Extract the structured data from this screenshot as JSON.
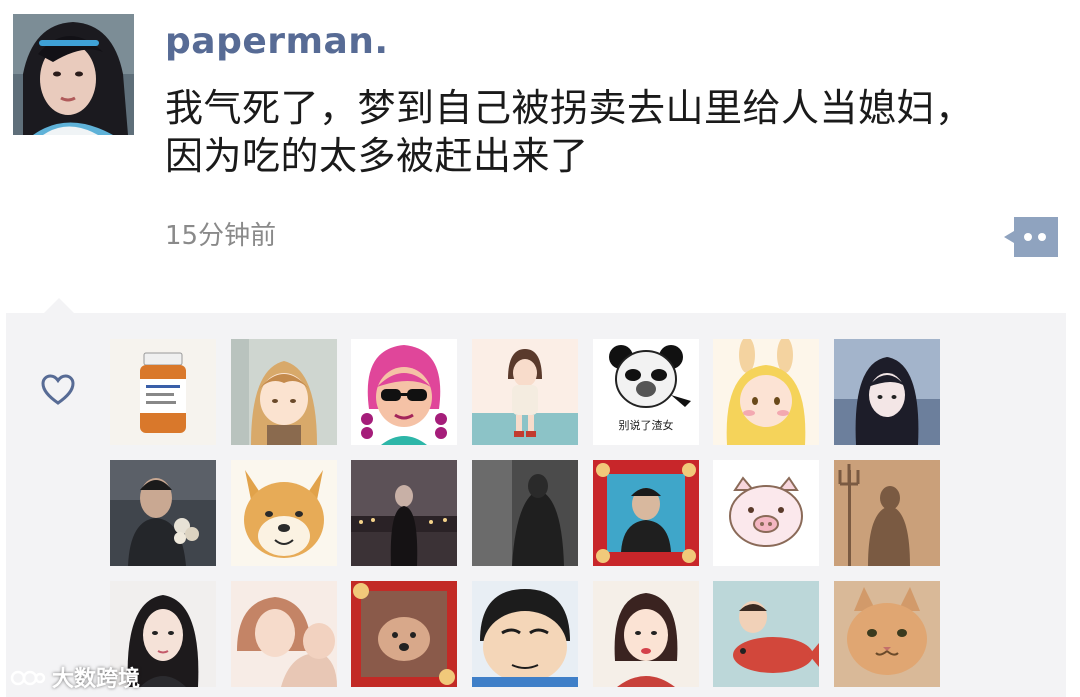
{
  "post": {
    "username": "paperman.",
    "text_line1": "我气死了，梦到自己被拐卖去山里给人当媳妇，",
    "text_line2": "因为吃的太多被赶出来了",
    "time": "15分钟前",
    "comment_icon": "comment-dots-icon"
  },
  "likes": {
    "icon": "heart-outline-icon",
    "rows": [
      [
        "liker-pill-bottle",
        "liker-anime-girl-bangs",
        "liker-pink-braids-sunglasses",
        "liker-doll-girl",
        "liker-panda-meme",
        "liker-bunny-ears-girl",
        "liker-dark-anime-girl"
      ],
      [
        "liker-man-flowers",
        "liker-shiba-dog",
        "liker-city-night",
        "liker-dark-room",
        "liker-red-frame-photo",
        "liker-pig-face",
        "liker-shadow-trident"
      ],
      [
        "liker-long-hair-girl",
        "liker-sketch-couple",
        "liker-red-dog-frame",
        "liker-cartoon-boy",
        "liker-bob-hair-girl",
        "liker-kid-fish",
        "liker-cat"
      ]
    ],
    "panda_meme_caption": "别说了渣女"
  },
  "watermark": {
    "text": "大数跨境"
  }
}
